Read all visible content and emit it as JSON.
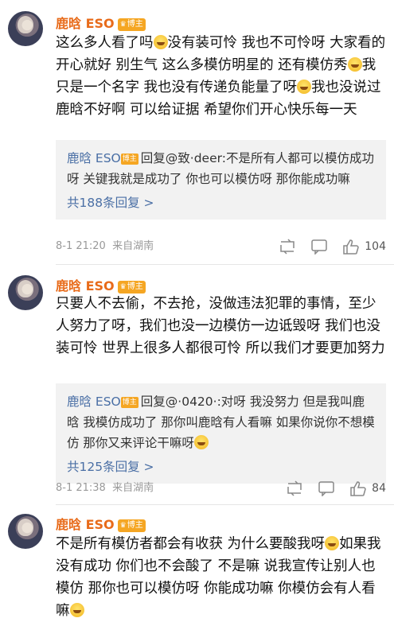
{
  "comments": [
    {
      "username": "鹿晗 ESO",
      "badge": "博主",
      "text_parts": [
        "这么多人看了吗",
        "没有装可怜 我也不可怜呀 大家看的开心就好 别生气 这么多模仿明星的 还有模仿秀",
        "我只是一个名字 我也没有传递负能量了呀",
        "我也没说过鹿晗不好啊 可以给证据 希望你们开心快乐每一天"
      ],
      "reply": {
        "name": "鹿晗 ESO",
        "badge": "博主",
        "text": "回复@致·deer:不是所有人都可以模仿成功呀 关键我就是成功了 你也可以模仿呀 那你能成功嘛",
        "count": "共188条回复 >"
      },
      "time": "8-1 21:20",
      "source": "来自湖南",
      "likes": "104"
    },
    {
      "username": "鹿晗 ESO",
      "badge": "博主",
      "text_parts": [
        "只要人不去偷，不去抢，没做违法犯罪的事情，至少人努力了呀，我们也没一边模仿一边诋毁呀 我们也没装可怜 世界上很多人都很可怜 所以我们才要更加努力"
      ],
      "reply": {
        "name": "鹿晗 ESO",
        "badge": "博主",
        "text": "回复@·0420·:对呀 我没努力 但是我叫鹿晗 我模仿成功了 那你叫鹿晗有人看嘛 如果你说你不想模仿 那你又来评论干嘛呀",
        "count": "共125条回复 >"
      },
      "time": "8-1 21:38",
      "source": "来自湖南",
      "likes": "84"
    },
    {
      "username": "鹿晗 ESO",
      "badge": "博主",
      "text_parts": [
        "不是所有模仿者都会有收获 为什么要酸我呀",
        "如果我没有成功 你们也不会酸了 不是嘛 说我宣传让别人也模仿 那你也可以模仿呀 你能成功嘛 你模仿会有人看嘛"
      ]
    }
  ],
  "icons": [
    "repost-icon",
    "comment-icon",
    "like-icon",
    "laugh-cry-emoji"
  ],
  "colors": {
    "username": "#e86b1a",
    "badge": "#f5a623",
    "reply_link": "#4a6fa5",
    "reply_bg": "#f2f2f2"
  }
}
